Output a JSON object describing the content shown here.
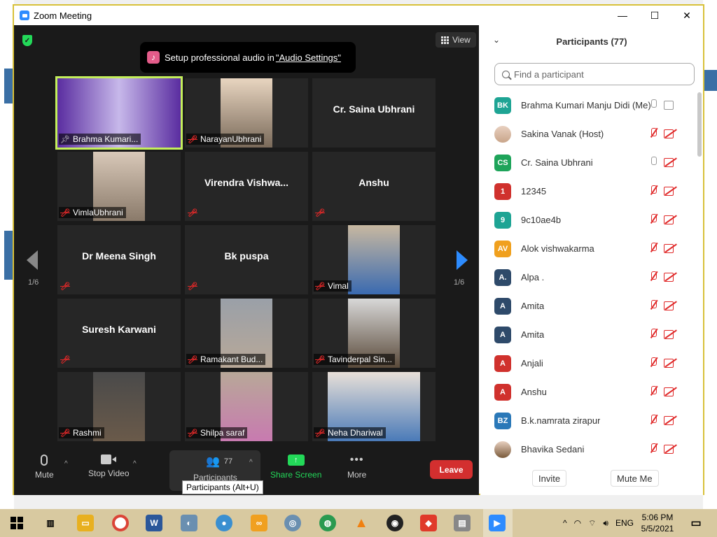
{
  "window": {
    "title": "Zoom Meeting",
    "controls": [
      "—",
      "☐",
      "✕"
    ]
  },
  "video": {
    "view_label": "View",
    "banner_text": "Setup professional audio in ",
    "banner_link": "\"Audio Settings\"",
    "page_left": "1/6",
    "page_right": "1/6",
    "tiles": [
      {
        "name": "Brahma Kumari...",
        "big": "",
        "video": true,
        "muted": false,
        "pinned": true,
        "active": true
      },
      {
        "name": "NarayanUbhrani",
        "big": "",
        "video": true,
        "muted": true
      },
      {
        "name": "",
        "big": "Cr. Saina Ubhrani",
        "video": false,
        "muted": false
      },
      {
        "name": "VimlaUbhrani",
        "big": "",
        "video": true,
        "muted": true
      },
      {
        "name": "",
        "big": "Virendra  Vishwa...",
        "video": false,
        "muted": true
      },
      {
        "name": "",
        "big": "Anshu",
        "video": false,
        "muted": true
      },
      {
        "name": "",
        "big": "Dr Meena Singh",
        "video": false,
        "muted": true
      },
      {
        "name": "",
        "big": "Bk puspa",
        "video": false,
        "muted": true
      },
      {
        "name": "Vimal",
        "big": "",
        "video": true,
        "muted": true
      },
      {
        "name": "",
        "big": "Suresh Karwani",
        "video": false,
        "muted": true
      },
      {
        "name": "Ramakant Bud...",
        "big": "",
        "video": true,
        "muted": true
      },
      {
        "name": "Tavinderpal Sin...",
        "big": "",
        "video": true,
        "muted": true
      },
      {
        "name": "Rashmi",
        "big": "",
        "video": true,
        "muted": true
      },
      {
        "name": "Shilpa saraf",
        "big": "",
        "video": true,
        "muted": true
      },
      {
        "name": "Neha Dhariwal",
        "big": "",
        "video": true,
        "muted": true
      }
    ]
  },
  "toolbar": {
    "mute": "Mute",
    "stop_video": "Stop Video",
    "participants_count": "77",
    "participants": "Participants",
    "share": "Share Screen",
    "more": "More",
    "leave": "Leave",
    "tooltip": "Participants (Alt+U)"
  },
  "panel": {
    "title": "Participants (77)",
    "search_placeholder": "Find a participant",
    "invite": "Invite",
    "mute_me": "Mute Me",
    "participants": [
      {
        "initials": "BK",
        "color": "#1ea494",
        "name": "Brahma Kumari Manju Didi (Me)",
        "mic": "on",
        "cam": "on"
      },
      {
        "initials": "",
        "color": "#c9a58a",
        "name": "Sakina Vanak (Host)",
        "mic": "off",
        "cam": "off",
        "photo": true
      },
      {
        "initials": "CS",
        "color": "#1ea45a",
        "name": "Cr. Saina Ubhrani",
        "mic": "on",
        "cam": "off"
      },
      {
        "initials": "1",
        "color": "#d0312d",
        "name": "12345",
        "mic": "off",
        "cam": "off"
      },
      {
        "initials": "9",
        "color": "#1ea494",
        "name": "9c10ae4b",
        "mic": "off",
        "cam": "off"
      },
      {
        "initials": "AV",
        "color": "#f0a01e",
        "name": "Alok vishwakarma",
        "mic": "off",
        "cam": "off"
      },
      {
        "initials": "A.",
        "color": "#2e4a6a",
        "name": "Alpa .",
        "mic": "off",
        "cam": "off"
      },
      {
        "initials": "A",
        "color": "#2e4a6a",
        "name": "Amita",
        "mic": "off",
        "cam": "off"
      },
      {
        "initials": "A",
        "color": "#2e4a6a",
        "name": "Amita",
        "mic": "off",
        "cam": "off"
      },
      {
        "initials": "A",
        "color": "#d0312d",
        "name": "Anjali",
        "mic": "off",
        "cam": "off"
      },
      {
        "initials": "A",
        "color": "#d0312d",
        "name": "Anshu",
        "mic": "off",
        "cam": "off"
      },
      {
        "initials": "BZ",
        "color": "#2a78b8",
        "name": "B.k.namrata zirapur",
        "mic": "off",
        "cam": "off"
      },
      {
        "initials": "",
        "color": "#7a5a3a",
        "name": "Bhavika Sedani",
        "mic": "off",
        "cam": "off",
        "photo": true
      }
    ]
  },
  "taskbar": {
    "lang": "ENG",
    "time": "5:06 PM",
    "date": "5/5/2021"
  }
}
